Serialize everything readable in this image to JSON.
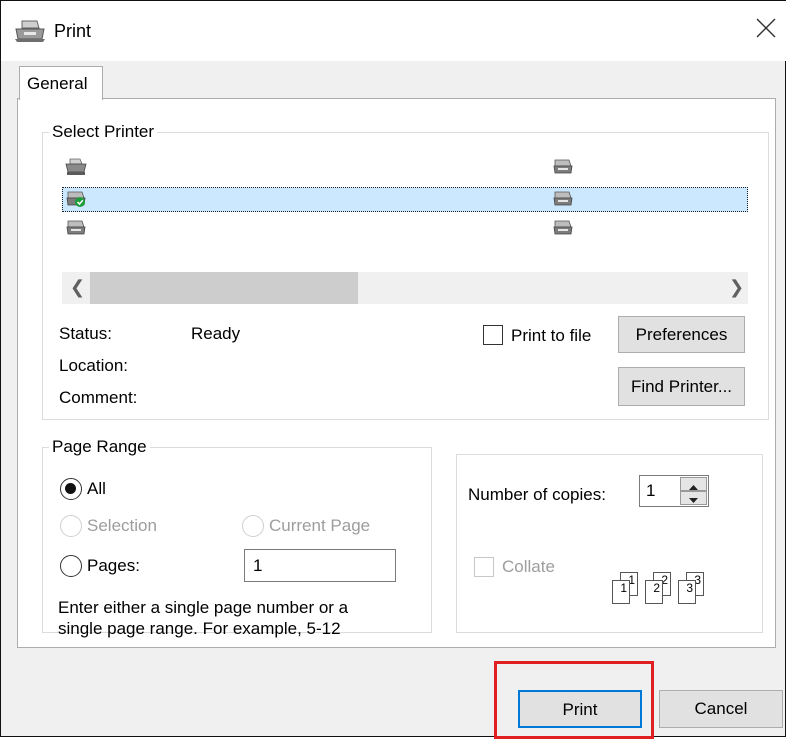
{
  "window": {
    "title": "Print"
  },
  "tabs": [
    {
      "label": "General"
    }
  ],
  "select_printer": {
    "legend": "Select Printer",
    "status_label": "Status:",
    "status_value": "Ready",
    "location_label": "Location:",
    "comment_label": "Comment:",
    "print_to_file_label": "Print to file",
    "preferences_label": "Preferences",
    "find_printer_label": "Find Printer..."
  },
  "page_range": {
    "legend": "Page Range",
    "all_label": "All",
    "selection_label": "Selection",
    "current_page_label": "Current Page",
    "pages_label": "Pages:",
    "pages_value": "1",
    "help_line1": "Enter either a single page number or a",
    "help_line2": "single page range.  For example, 5-12"
  },
  "copies": {
    "label": "Number of copies:",
    "value": "1",
    "collate_label": "Collate",
    "collate_icon": [
      {
        "small": "1",
        "big": "1"
      },
      {
        "small": "2",
        "big": "2"
      },
      {
        "small": "3",
        "big": "3"
      }
    ]
  },
  "buttons": {
    "print_label": "Print",
    "cancel_label": "Cancel"
  },
  "colors": {
    "accent": "#0078d7",
    "highlight": "#e02020",
    "selected_row": "#cce8ff"
  }
}
